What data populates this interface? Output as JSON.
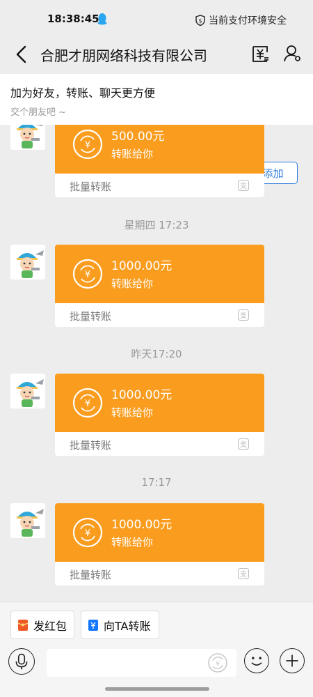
{
  "status_bar": {
    "time": "18:38:45",
    "security_text": "当前支付环境安全"
  },
  "nav": {
    "title": "合肥才朋网络科技有限公司",
    "icons": [
      "back-arrow-icon",
      "bill-icon",
      "profile-icon"
    ]
  },
  "friend_banner": {
    "main_text": "加为好友，转账、聊天更方便",
    "sub_text": "交个朋友吧 ~",
    "add_button": "添加"
  },
  "messages": [
    {
      "amount": "500.00元",
      "desc": "转账给你",
      "footer": "批量转账"
    },
    {
      "time": "星期四 17:23",
      "amount": "1000.00元",
      "desc": "转账给你",
      "footer": "批量转账"
    },
    {
      "time": "昨天17:20",
      "amount": "1000.00元",
      "desc": "转账给你",
      "footer": "批量转账"
    },
    {
      "time": "17:17",
      "amount": "1000.00元",
      "desc": "转账给你",
      "footer": "批量转账"
    }
  ],
  "quick_actions": [
    {
      "label": "发红包",
      "icon": "red-packet-icon"
    },
    {
      "label": "向TA转账",
      "icon": "transfer-icon"
    }
  ],
  "colors": {
    "card_orange": "#fa9d1f",
    "accent_blue": "#2d7bd8",
    "background": "#ededed"
  }
}
